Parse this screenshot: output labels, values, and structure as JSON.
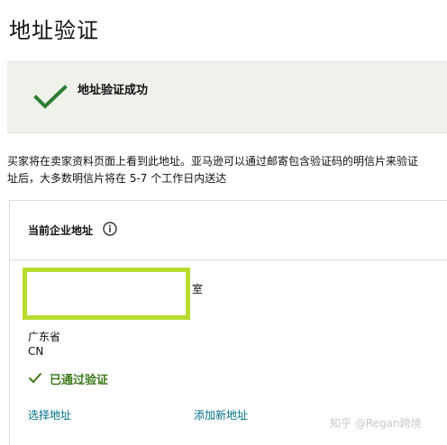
{
  "page": {
    "title": "地址验证"
  },
  "success_banner": {
    "message": "地址验证成功",
    "icon": "check-icon",
    "color": "#2e7d32"
  },
  "description": {
    "line1": "买家将在卖家资料页面上看到此地址。亚马逊可以通过邮寄包含验证码的明信片来验证",
    "line2": "址后，大多数明信片将在 5-7 个工作日内送达"
  },
  "address_card": {
    "title": "当前企业地址",
    "info_icon": "info-icon",
    "address_tail": "室",
    "province": "广东省",
    "country": "CN",
    "verified_label": "已通过验证",
    "verified_color": "#3d7a1a",
    "highlight_color": "#b8dc2e",
    "select_address_label": "选择地址",
    "add_address_label": "添加新地址",
    "link_color": "#007185"
  },
  "watermark": {
    "text": "知乎 @Regan跨境"
  }
}
